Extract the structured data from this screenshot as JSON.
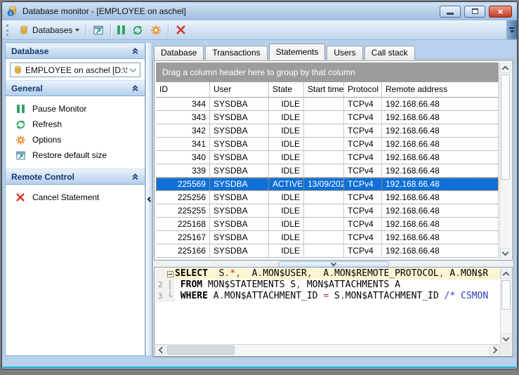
{
  "window": {
    "title": "Database monitor - [EMPLOYEE on aschel]"
  },
  "toolbar": {
    "databases_label": "Databases"
  },
  "sidebar": {
    "sections": {
      "database": "Database",
      "general": "General",
      "remote": "Remote Control"
    },
    "database_combo": "EMPLOYEE on aschel [D:\\Shar",
    "general_items": [
      "Pause Monitor",
      "Refresh",
      "Options",
      "Restore default size"
    ],
    "remote_items": [
      "Cancel Statement"
    ]
  },
  "tabs": {
    "items": [
      "Database",
      "Transactions",
      "Statements",
      "Users",
      "Call stack"
    ],
    "active": "Statements"
  },
  "grid": {
    "group_hint": "Drag a column header here to group by that column",
    "columns": [
      "ID",
      "User",
      "State",
      "Start time",
      "Protocol",
      "Remote address"
    ],
    "selected_id": "225569",
    "rows": [
      {
        "id": "344",
        "user": "SYSDBA",
        "state": "IDLE",
        "start": "",
        "protocol": "TCPv4",
        "remote": "192.168.66.48"
      },
      {
        "id": "343",
        "user": "SYSDBA",
        "state": "IDLE",
        "start": "",
        "protocol": "TCPv4",
        "remote": "192.168.66.48"
      },
      {
        "id": "342",
        "user": "SYSDBA",
        "state": "IDLE",
        "start": "",
        "protocol": "TCPv4",
        "remote": "192.168.66.48"
      },
      {
        "id": "341",
        "user": "SYSDBA",
        "state": "IDLE",
        "start": "",
        "protocol": "TCPv4",
        "remote": "192.168.66.48"
      },
      {
        "id": "340",
        "user": "SYSDBA",
        "state": "IDLE",
        "start": "",
        "protocol": "TCPv4",
        "remote": "192.168.66.48"
      },
      {
        "id": "339",
        "user": "SYSDBA",
        "state": "IDLE",
        "start": "",
        "protocol": "TCPv4",
        "remote": "192.168.66.48"
      },
      {
        "id": "225569",
        "user": "SYSDBA",
        "state": "ACTIVE",
        "start": "13/09/202",
        "protocol": "TCPv4",
        "remote": "192.168.66.48"
      },
      {
        "id": "225256",
        "user": "SYSDBA",
        "state": "IDLE",
        "start": "",
        "protocol": "TCPv4",
        "remote": "192.168.66.48"
      },
      {
        "id": "225255",
        "user": "SYSDBA",
        "state": "IDLE",
        "start": "",
        "protocol": "TCPv4",
        "remote": "192.168.66.48"
      },
      {
        "id": "225168",
        "user": "SYSDBA",
        "state": "IDLE",
        "start": "",
        "protocol": "TCPv4",
        "remote": "192.168.66.48"
      },
      {
        "id": "225167",
        "user": "SYSDBA",
        "state": "IDLE",
        "start": "",
        "protocol": "TCPv4",
        "remote": "192.168.66.48"
      },
      {
        "id": "225166",
        "user": "SYSDBA",
        "state": "IDLE",
        "start": "",
        "protocol": "TCPv4",
        "remote": "192.168.66.48"
      }
    ]
  },
  "sql": {
    "lines": [
      {
        "num": "",
        "fold": "open",
        "current": true,
        "tokens": [
          [
            "kw",
            "SELECT"
          ],
          [
            "id",
            "  S"
          ],
          [
            "sym",
            ".*,"
          ],
          [
            "id",
            "  A"
          ],
          [
            "sym",
            "."
          ],
          [
            "id",
            "MON$USER"
          ],
          [
            "sym",
            ","
          ],
          [
            "id",
            "  A"
          ],
          [
            "sym",
            "."
          ],
          [
            "id",
            "MON$REMOTE_PROTOCOL"
          ],
          [
            "sym",
            ","
          ],
          [
            "id",
            " A"
          ],
          [
            "sym",
            "."
          ],
          [
            "id",
            "MON$R"
          ]
        ]
      },
      {
        "num": "2",
        "fold": "mid",
        "current": false,
        "tokens": [
          [
            "id",
            " "
          ],
          [
            "kw",
            "FROM"
          ],
          [
            "id",
            " MON$STATEMENTS S"
          ],
          [
            "sym",
            ","
          ],
          [
            "id",
            " MON$ATTACHMENTS A"
          ]
        ]
      },
      {
        "num": "3",
        "fold": "end",
        "current": false,
        "tokens": [
          [
            "id",
            " "
          ],
          [
            "kw",
            "WHERE"
          ],
          [
            "id",
            " A"
          ],
          [
            "sym",
            "."
          ],
          [
            "id",
            "MON$ATTACHMENT_ID "
          ],
          [
            "sym",
            "="
          ],
          [
            "id",
            " S"
          ],
          [
            "sym",
            "."
          ],
          [
            "id",
            "MON$ATTACHMENT_ID "
          ],
          [
            "cm",
            "/* CSMON"
          ]
        ]
      }
    ]
  },
  "colors": {
    "selection_blue": "#1070d8",
    "accent_teal": "#17b0cf",
    "pause_green": "#35a263",
    "options_orange": "#ef9231",
    "cancel_red": "#d2352b",
    "symbol_red": "#b03333",
    "comment_blue": "#2b3cc4",
    "group_panel_gray": "#9c9c9c"
  }
}
